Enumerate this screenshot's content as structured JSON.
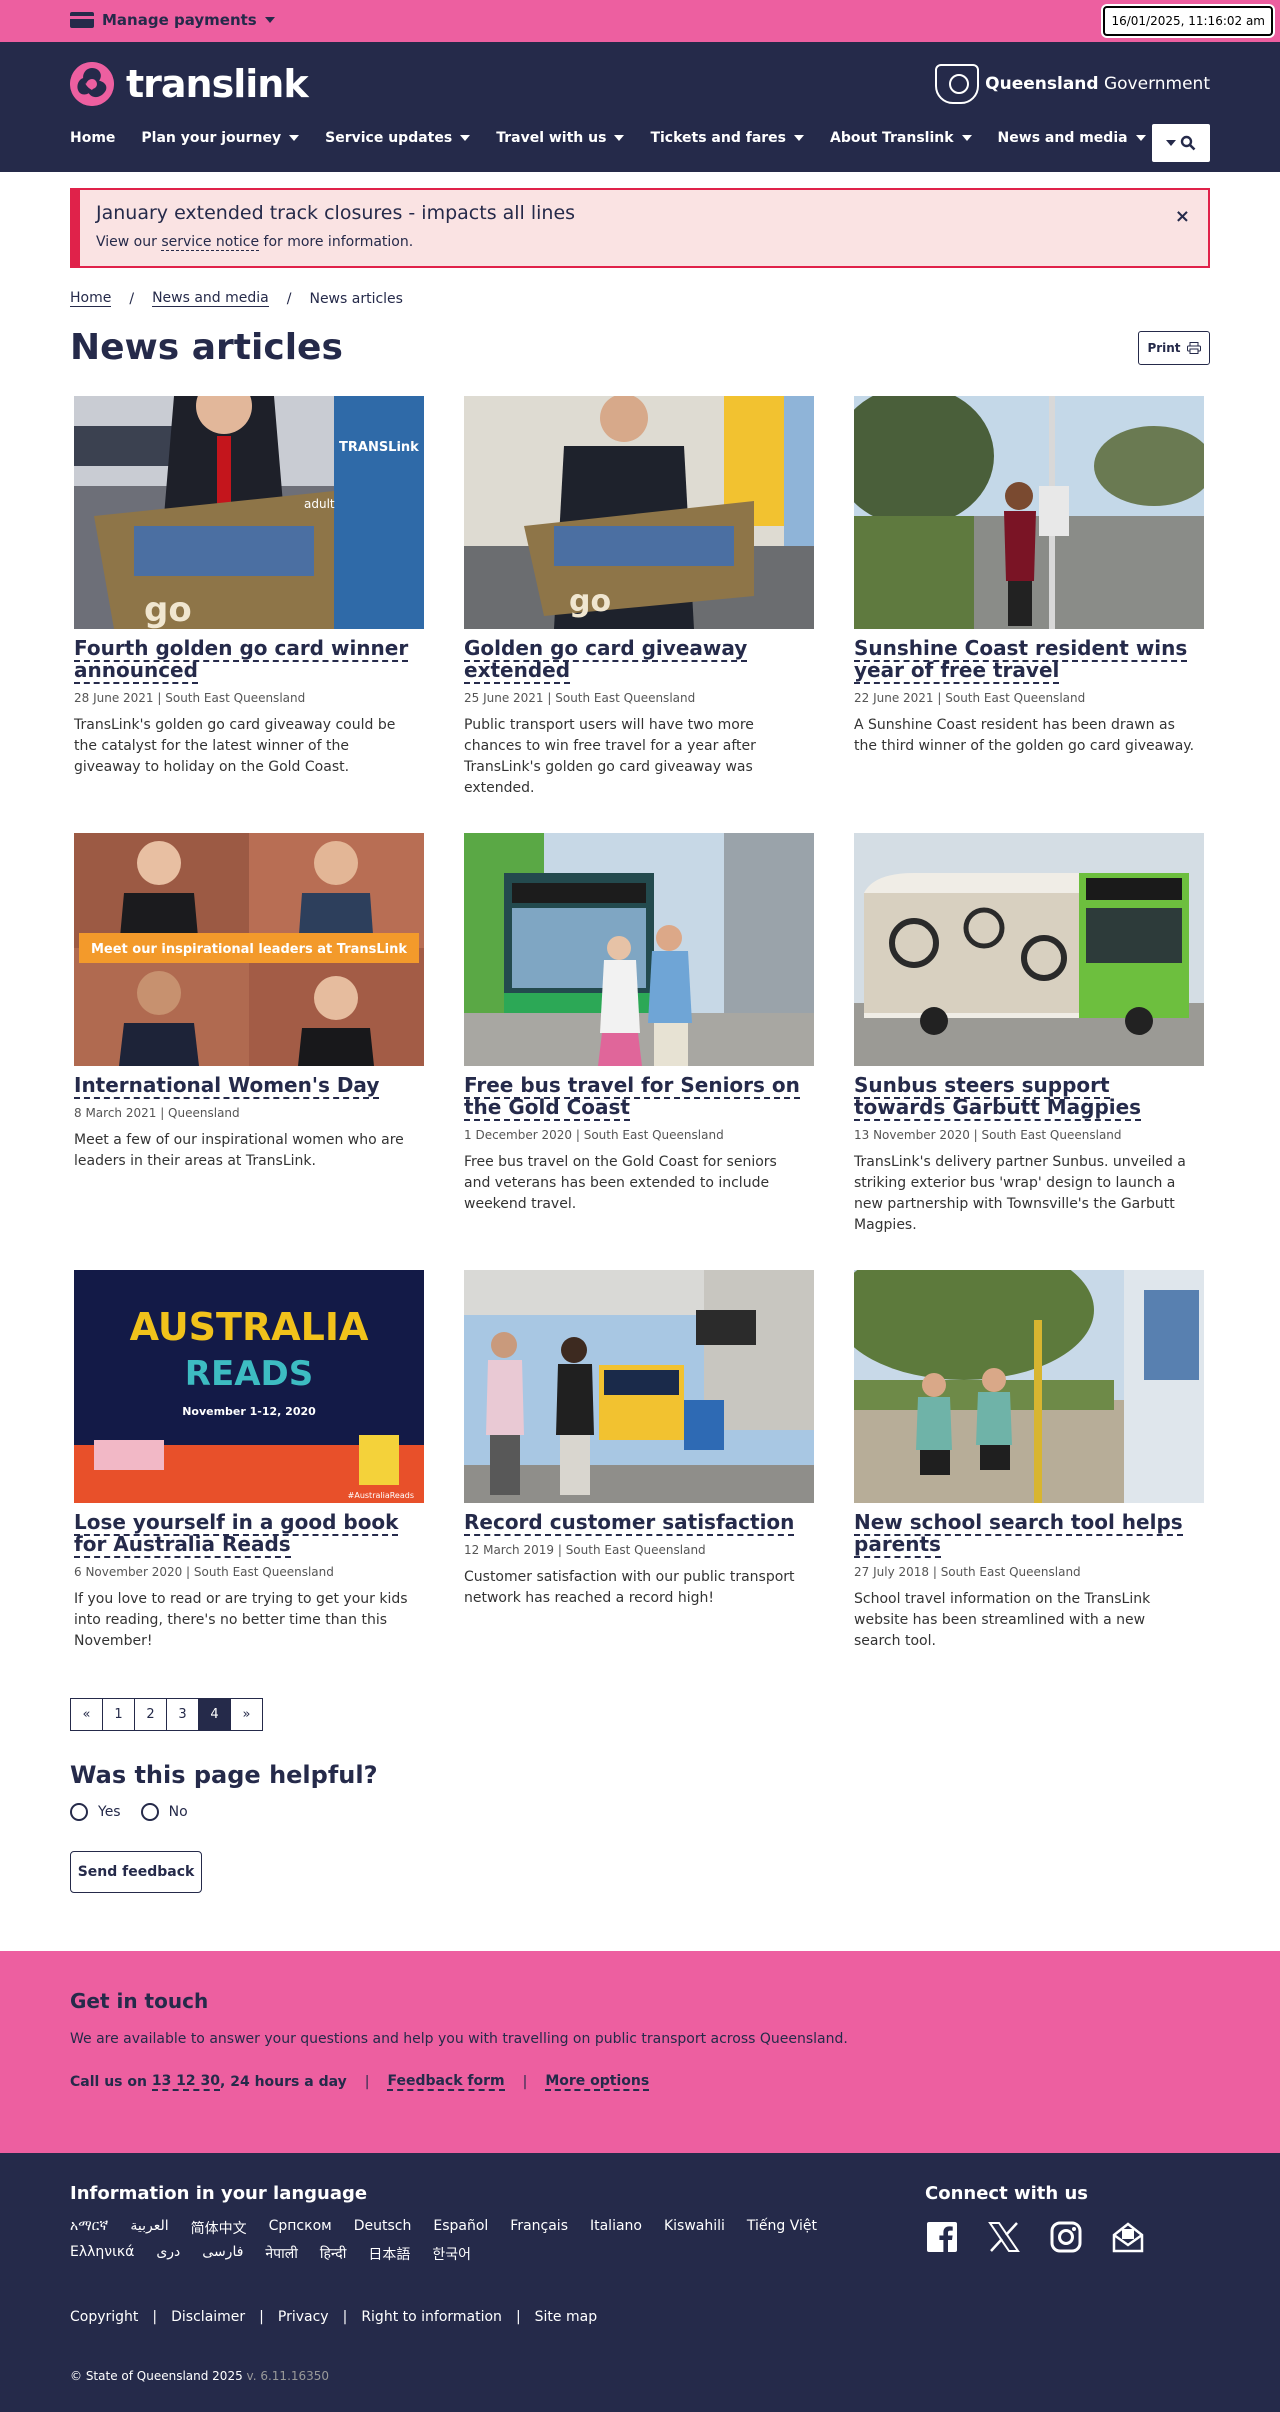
{
  "topbar": {
    "manage_payments": "Manage payments",
    "clock": "16/01/2025, 11:16:02 am"
  },
  "header": {
    "logo_text": "translink",
    "gov_bold": "Queensland",
    "gov_light": "Government",
    "nav": [
      "Home",
      "Plan your journey",
      "Service updates",
      "Travel with us",
      "Tickets and fares",
      "About Translink",
      "News and media"
    ]
  },
  "alert": {
    "title": "January extended track closures - impacts all lines",
    "text_before": "View our",
    "link": "service notice",
    "text_after": "for more information.",
    "close": "×"
  },
  "breadcrumb": [
    "Home",
    "News and media",
    "News articles"
  ],
  "page": {
    "title": "News articles",
    "print": "Print"
  },
  "articles": [
    {
      "title": "Fourth golden go card winner announced",
      "meta": "28 June 2021 | South East Queensland",
      "desc": "TransLink's golden go card giveaway could be the catalyst for the latest winner of the giveaway to holiday on the Gold Coast."
    },
    {
      "title": "Golden go card giveaway extended",
      "meta": "25 June 2021 | South East Queensland",
      "desc": "Public transport users will have two more chances to win free travel for a year after TransLink's golden go card giveaway was extended."
    },
    {
      "title": "Sunshine Coast resident wins year of free travel",
      "meta": "22 June 2021 | South East Queensland",
      "desc": "A Sunshine Coast resident has been drawn as the third winner of the golden go card giveaway."
    },
    {
      "title": "International Women's Day",
      "meta": "8 March 2021 | Queensland",
      "desc": "Meet a few of our inspirational women who are leaders in their areas at TransLink."
    },
    {
      "title": "Free bus travel for Seniors on the Gold Coast",
      "meta": "1 December 2020 | South East Queensland",
      "desc": "Free bus travel on the Gold Coast for seniors and veterans has been extended to include weekend travel."
    },
    {
      "title": "Sunbus steers support towards Garbutt Magpies",
      "meta": "13 November 2020 | South East Queensland",
      "desc": "TransLink's delivery partner Sunbus. unveiled a striking exterior bus 'wrap' design to launch a new partnership with Townsville's the Garbutt Magpies."
    },
    {
      "title": "Lose yourself in a good book for Australia Reads",
      "meta": "6 November 2020 | South East Queensland",
      "desc": "If you love to read or are trying to get your kids into reading, there's no better time than this November!"
    },
    {
      "title": "Record customer satisfaction",
      "meta": "12 March 2019 | South East Queensland",
      "desc": "Customer satisfaction with our public transport network has reached a record high!"
    },
    {
      "title": "New school search tool helps parents",
      "meta": "27 July 2018 | South East Queensland",
      "desc": "School travel information on the TransLink website has been streamlined with a new search tool."
    }
  ],
  "image_text": {
    "women_banner": "Meet our inspirational leaders at TransLink",
    "reads_line1": "AUSTRALIA",
    "reads_line2": "READS",
    "reads_date": "November 1-12, 2020",
    "reads_tag": "#AustraliaReads",
    "card_adult": "adult",
    "card_brand": "TRANSLink"
  },
  "pagination": [
    "«",
    "1",
    "2",
    "3",
    "4",
    "»"
  ],
  "pagination_current": "4",
  "feedback": {
    "title": "Was this page helpful?",
    "yes": "Yes",
    "no": "No",
    "send": "Send feedback"
  },
  "get_in_touch": {
    "title": "Get in touch",
    "text": "We are available to answer your questions and help you with travelling on public transport across Queensland.",
    "call_before": "Call us on",
    "phone": "13 12 30",
    "call_after": ", 24 hours a day",
    "sep": "|",
    "feedback_form": "Feedback form",
    "more_options": "More options"
  },
  "footer": {
    "lang_title": "Information in your language",
    "languages": [
      "አማርኛ",
      "العربية",
      "简体中文",
      "Српском",
      "Deutsch",
      "Español",
      "Français",
      "Italiano",
      "Kiswahili",
      "Tiếng Việt",
      "Ελληνικά",
      "دری",
      "فارسی",
      "नेपाली",
      "हिन्दी",
      "日本語",
      "한국어"
    ],
    "connect_title": "Connect with us",
    "links": [
      "Copyright",
      "Disclaimer",
      "Privacy",
      "Right to information",
      "Site map"
    ],
    "copyright": "© State of Queensland 2025",
    "version": "v. 6.11.16350"
  },
  "colors": {
    "brand_pink": "#ed5fa0",
    "navy": "#252a4a",
    "alert_red": "#e0224a"
  }
}
